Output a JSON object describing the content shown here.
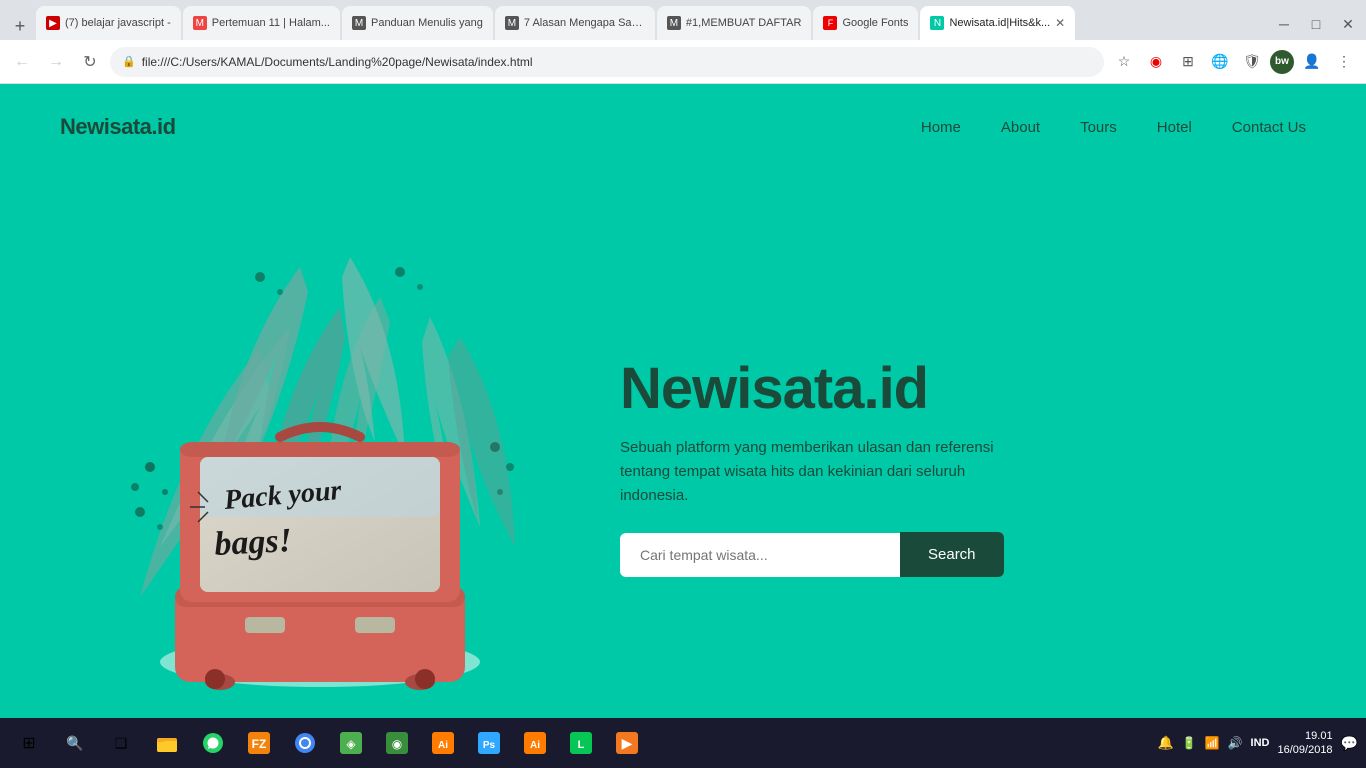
{
  "browser": {
    "tabs": [
      {
        "id": 1,
        "favicon_color": "#c00",
        "favicon_text": "▶",
        "label": "(7) belajar javascript -",
        "active": false
      },
      {
        "id": 2,
        "favicon_color": "#e44",
        "favicon_text": "M",
        "label": "Pertemuan 11 | Halam...",
        "active": false
      },
      {
        "id": 3,
        "favicon_color": "#555",
        "favicon_text": "M",
        "label": "Panduan Menulis yang",
        "active": false
      },
      {
        "id": 4,
        "favicon_color": "#555",
        "favicon_text": "M",
        "label": "7 Alasan Mengapa Say...",
        "active": false
      },
      {
        "id": 5,
        "favicon_color": "#555",
        "favicon_text": "M",
        "label": "#1,MEMBUAT DAFTAR",
        "active": false
      },
      {
        "id": 6,
        "favicon_color": "#e00",
        "favicon_text": "F",
        "label": "Google Fonts",
        "active": false
      },
      {
        "id": 7,
        "favicon_color": "#00c9a7",
        "favicon_text": "N",
        "label": "Newisata.id|Hits&k...",
        "active": true
      }
    ],
    "url": "file:///C:/Users/KAMAL/Documents/Landing%20page/Newisata/index.html",
    "new_tab_label": "+"
  },
  "site": {
    "logo": "Newisata.id",
    "nav": {
      "items": [
        {
          "label": "Home"
        },
        {
          "label": "About"
        },
        {
          "label": "Tours"
        },
        {
          "label": "Hotel"
        },
        {
          "label": "Contact Us"
        }
      ]
    },
    "hero": {
      "title": "Newisata.id",
      "subtitle": "Sebuah platform yang memberikan ulasan dan referensi tentang tempat wisata hits dan kekinian dari seluruh indonesia.",
      "search_placeholder": "Cari tempat wisata...",
      "search_button": "Search"
    }
  },
  "taskbar": {
    "time": "19.01",
    "date": "16/09/2018",
    "language": "IND",
    "apps": [
      {
        "name": "windows-start",
        "symbol": "⊞",
        "color": "#fff"
      },
      {
        "name": "search",
        "symbol": "🔍",
        "color": "#fff"
      },
      {
        "name": "task-view",
        "symbol": "❑",
        "color": "#fff"
      },
      {
        "name": "file-explorer",
        "symbol": "📁",
        "color": "#f9a825"
      },
      {
        "name": "whatsapp",
        "symbol": "💬",
        "color": "#25d366"
      },
      {
        "name": "filezilla",
        "symbol": "⚡",
        "color": "#f4830b"
      },
      {
        "name": "chrome",
        "symbol": "◉",
        "color": "#4285f4"
      },
      {
        "name": "app7",
        "symbol": "◈",
        "color": "#4caf50"
      },
      {
        "name": "app8",
        "symbol": "◉",
        "color": "#4caf50"
      },
      {
        "name": "illustrator",
        "symbol": "Ai",
        "color": "#ff7c00"
      },
      {
        "name": "photoshop",
        "symbol": "Ps",
        "color": "#31a8ff"
      },
      {
        "name": "illustrator2",
        "symbol": "Ai",
        "color": "#ff7c00"
      },
      {
        "name": "line",
        "symbol": "L",
        "color": "#06c755"
      },
      {
        "name": "vlc",
        "symbol": "▶",
        "color": "#f47820"
      }
    ]
  }
}
